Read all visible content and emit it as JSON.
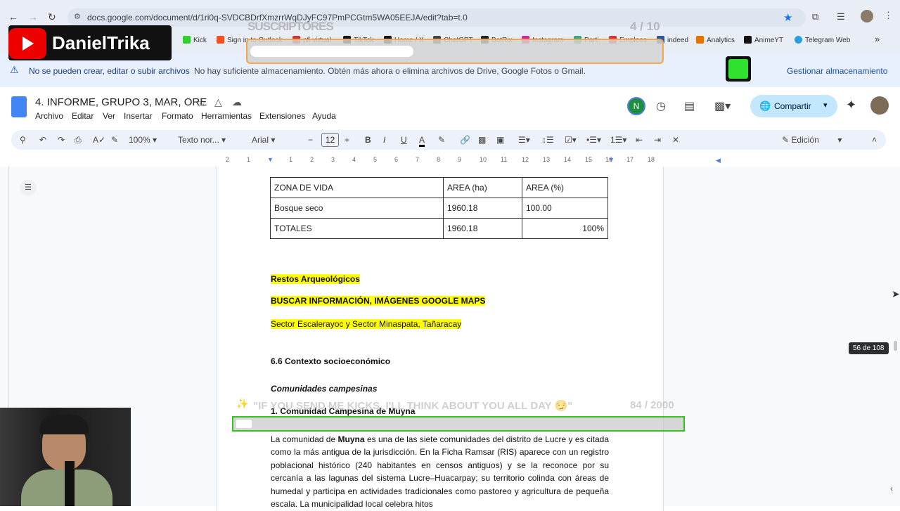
{
  "browser": {
    "url": "docs.google.com/document/d/1ri0q-SVDCBDrfXmzrrWqDJyFC97PmPCGtm5WA05EEJA/edit?tab=t.0",
    "bookmarks": [
      "Kick",
      "Sign in to Outlook",
      "pfi virtual",
      "TikTok",
      "Home / X",
      "ChatGPT",
      "BotRix",
      "Instagram",
      "Parti",
      "Empleos",
      "indeed",
      "Analytics",
      "AnimeYT",
      "Telegram Web"
    ]
  },
  "overlay": {
    "channel": "DanielTrika",
    "subs_label": "SUSCRIPTORES",
    "subs_count": "4 / 10",
    "kicks_text": "\"IF YOU SEND ME KICKS, I'LL THINK ABOUT YOU ALL DAY 😏\"",
    "kicks_count": "84 / 2000"
  },
  "notice": {
    "title": "No se pueden crear, editar o subir archivos",
    "message": "No hay suficiente almacenamiento. Obtén más ahora o elimina archivos de Drive, Google Fotos o Gmail.",
    "action": "Gestionar almacenamiento"
  },
  "docs": {
    "title": "4. INFORME, GRUPO 3, MAR, ORE",
    "menu": [
      "Archivo",
      "Editar",
      "Ver",
      "Insertar",
      "Formato",
      "Herramientas",
      "Extensiones",
      "Ayuda"
    ],
    "avatar_letter": "N",
    "share": "Compartir",
    "mode": "Edición",
    "zoom": "100%",
    "style": "Texto nor...",
    "font": "Arial",
    "font_size": "12",
    "page_counter": "56 de 108",
    "ruler": [
      "2",
      "1",
      "1",
      "2",
      "3",
      "4",
      "5",
      "6",
      "7",
      "8",
      "9",
      "10",
      "11",
      "12",
      "13",
      "14",
      "15",
      "16",
      "17",
      "18"
    ]
  },
  "document": {
    "table": [
      [
        "ZONA DE VIDA",
        "AREA (ha)",
        "AREA (%)"
      ],
      [
        "Bosque seco",
        "1960.18",
        "100.00"
      ],
      [
        "TOTALES",
        "1960.18",
        "100%"
      ]
    ],
    "h_restos": "Restos Arqueológicos",
    "h_buscar": "BUSCAR INFORMACIÓN, IMÁGENES GOOGLE MAPS",
    "sectores": "Sector Escalerayoc y Sector Minaspata, Tañaracay",
    "section": "6.6 Contexto socioeconómico",
    "subsection": "Comunidades campesinas",
    "item1": "1. Comunidad Campesina de Muyna",
    "para_prefix": "La comunidad de ",
    "para_bold": "Muyna",
    "para_rest": " es una de las siete comunidades del distrito de Lucre y es citada como la más antigua de la jurisdicción. En la Ficha Ramsar (RIS) aparece con un registro poblacional histórico (240 habitantes en censos antiguos) y se la reconoce por su cercanía a las lagunas del sistema Lucre–Huacarpay; su territorio colinda con áreas de humedal y participa en actividades tradicionales como pastoreo y agricultura de pequeña escala. La municipalidad local celebra hitos"
  },
  "colors": {
    "highlight": "#ffff00",
    "accent": "#1a73e8",
    "share_bg": "#c2e7ff"
  }
}
